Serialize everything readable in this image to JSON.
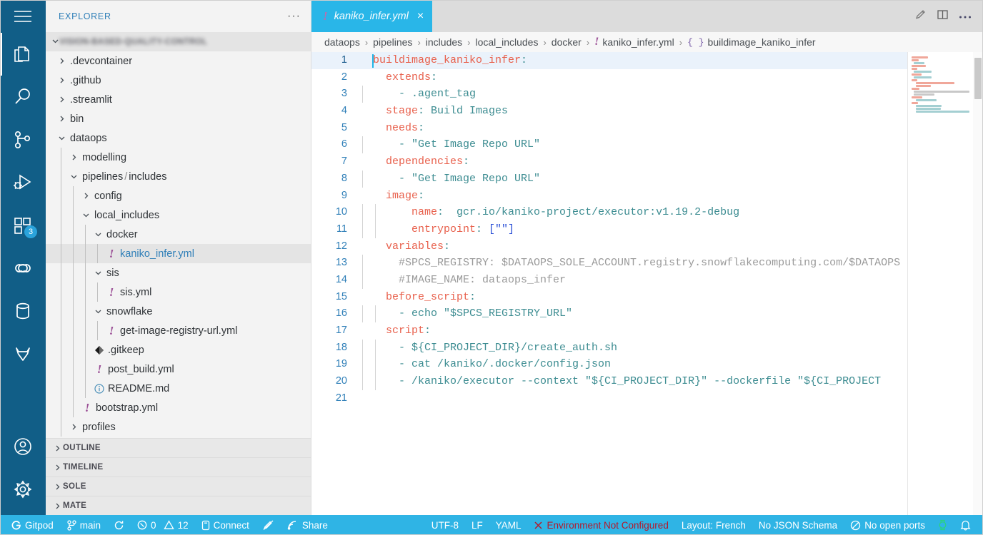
{
  "activitybar": {
    "items": [
      {
        "name": "menu-hamburger",
        "icon": "hamburger-icon",
        "label": "Menu"
      },
      {
        "name": "explorer",
        "icon": "files-icon",
        "label": "Explorer",
        "active": true
      },
      {
        "name": "search",
        "icon": "search-icon",
        "label": "Search"
      },
      {
        "name": "source-control",
        "icon": "source-control-icon",
        "label": "Source Control"
      },
      {
        "name": "run-debug",
        "icon": "run-and-debug-icon",
        "label": "Run and Debug"
      },
      {
        "name": "extensions",
        "icon": "extensions-icon",
        "label": "Extensions",
        "badge": "3"
      },
      {
        "name": "link",
        "icon": "chain-link-icon",
        "label": "Connections"
      },
      {
        "name": "database",
        "icon": "database-icon",
        "label": "Database"
      },
      {
        "name": "gitlab",
        "icon": "gitlab-fox-icon",
        "label": "GitLab"
      }
    ],
    "bottom_items": [
      {
        "name": "accounts",
        "icon": "account-circle-icon",
        "label": "Accounts"
      },
      {
        "name": "manage",
        "icon": "gear-icon",
        "label": "Manage"
      }
    ]
  },
  "sidebar": {
    "title": "EXPLORER",
    "more_actions": "···",
    "workspace": "VISION-BASED-QUALITY-CONTROL",
    "tree": [
      {
        "label": ".devcontainer",
        "type": "folder",
        "expanded": false,
        "depth": 1
      },
      {
        "label": ".github",
        "type": "folder",
        "expanded": false,
        "depth": 1
      },
      {
        "label": ".streamlit",
        "type": "folder",
        "expanded": false,
        "depth": 1
      },
      {
        "label": "bin",
        "type": "folder",
        "expanded": false,
        "depth": 1
      },
      {
        "label": "dataops",
        "type": "folder",
        "expanded": true,
        "depth": 1
      },
      {
        "label": "modelling",
        "type": "folder",
        "expanded": false,
        "depth": 2
      },
      {
        "label": "pipelines",
        "label2": "includes",
        "type": "folder",
        "expanded": true,
        "depth": 2
      },
      {
        "label": "config",
        "type": "folder",
        "expanded": false,
        "depth": 3
      },
      {
        "label": "local_includes",
        "type": "folder",
        "expanded": true,
        "depth": 3
      },
      {
        "label": "docker",
        "type": "folder",
        "expanded": true,
        "depth": 4
      },
      {
        "label": "kaniko_infer.yml",
        "type": "file",
        "icon": "yaml-icon",
        "depth": 5,
        "selected": true
      },
      {
        "label": "sis",
        "type": "folder",
        "expanded": true,
        "depth": 4
      },
      {
        "label": "sis.yml",
        "type": "file",
        "icon": "yaml-icon",
        "depth": 5
      },
      {
        "label": "snowflake",
        "type": "folder",
        "expanded": true,
        "depth": 4
      },
      {
        "label": "get-image-registry-url.yml",
        "type": "file",
        "icon": "yaml-icon",
        "depth": 5
      },
      {
        "label": ".gitkeep",
        "type": "file",
        "icon": "git-icon",
        "depth": 4
      },
      {
        "label": "post_build.yml",
        "type": "file",
        "icon": "yaml-icon",
        "depth": 4
      },
      {
        "label": "README.md",
        "type": "file",
        "icon": "info-icon",
        "depth": 4
      },
      {
        "label": "bootstrap.yml",
        "type": "file",
        "icon": "yaml-icon",
        "depth": 3
      },
      {
        "label": "profiles",
        "type": "folder",
        "expanded": false,
        "depth": 2
      }
    ],
    "sections": [
      "OUTLINE",
      "TIMELINE",
      "SOLE",
      "MATE"
    ]
  },
  "editor": {
    "tab": {
      "filename": "kaniko_infer.yml",
      "icon": "yaml-icon",
      "close": "×",
      "active": true
    },
    "actions": [
      {
        "name": "edit-pencil-icon",
        "label": "Edit"
      },
      {
        "name": "split-editor-icon",
        "label": "Split Editor"
      },
      {
        "name": "more-actions-icon",
        "label": "More Actions"
      }
    ],
    "breadcrumbs": [
      "dataops",
      "pipelines",
      "includes",
      "local_includes",
      "docker",
      "kaniko_infer.yml",
      "buildimage_kaniko_infer"
    ],
    "breadcrumb_file_index": 5,
    "breadcrumb_symbol": "{ }",
    "language": "YAML",
    "cursor_line": 1,
    "lines": [
      {
        "n": 1,
        "indent": 0,
        "highlight": true,
        "tokens": [
          {
            "t": "buildimage_kaniko_infer",
            "c": "key"
          },
          {
            "t": ":",
            "c": "punct"
          }
        ]
      },
      {
        "n": 2,
        "indent": 0,
        "tokens": [
          {
            "t": "  ",
            "c": "plain"
          },
          {
            "t": "extends",
            "c": "key"
          },
          {
            "t": ":",
            "c": "punct"
          }
        ]
      },
      {
        "n": 3,
        "indent": 1,
        "tokens": [
          {
            "t": "    - .agent_tag",
            "c": "val"
          }
        ]
      },
      {
        "n": 4,
        "indent": 0,
        "tokens": [
          {
            "t": "  ",
            "c": "plain"
          },
          {
            "t": "stage",
            "c": "key"
          },
          {
            "t": ": Build Images",
            "c": "val"
          }
        ]
      },
      {
        "n": 5,
        "indent": 0,
        "tokens": [
          {
            "t": "  ",
            "c": "plain"
          },
          {
            "t": "needs",
            "c": "key"
          },
          {
            "t": ":",
            "c": "punct"
          }
        ]
      },
      {
        "n": 6,
        "indent": 1,
        "tokens": [
          {
            "t": "    - \"Get Image Repo URL\"",
            "c": "val"
          }
        ]
      },
      {
        "n": 7,
        "indent": 0,
        "tokens": [
          {
            "t": "  ",
            "c": "plain"
          },
          {
            "t": "dependencies",
            "c": "key"
          },
          {
            "t": ":",
            "c": "punct"
          }
        ]
      },
      {
        "n": 8,
        "indent": 1,
        "tokens": [
          {
            "t": "    - \"Get Image Repo URL\"",
            "c": "val"
          }
        ]
      },
      {
        "n": 9,
        "indent": 0,
        "tokens": [
          {
            "t": "  ",
            "c": "plain"
          },
          {
            "t": "image",
            "c": "key"
          },
          {
            "t": ":",
            "c": "punct"
          }
        ]
      },
      {
        "n": 10,
        "indent": 2,
        "tokens": [
          {
            "t": "      ",
            "c": "plain"
          },
          {
            "t": "name",
            "c": "key"
          },
          {
            "t": ":  gcr.io/kaniko-project/executor:v1.19.2-debug",
            "c": "val"
          }
        ]
      },
      {
        "n": 11,
        "indent": 2,
        "tokens": [
          {
            "t": "      ",
            "c": "plain"
          },
          {
            "t": "entrypoint",
            "c": "key"
          },
          {
            "t": ": ",
            "c": "punct"
          },
          {
            "t": "[\"\"]",
            "c": "bracket"
          }
        ]
      },
      {
        "n": 12,
        "indent": 0,
        "tokens": [
          {
            "t": "  ",
            "c": "plain"
          },
          {
            "t": "variables",
            "c": "key"
          },
          {
            "t": ":",
            "c": "punct"
          }
        ]
      },
      {
        "n": 13,
        "indent": 1,
        "tokens": [
          {
            "t": "    #SPCS_REGISTRY: $DATAOPS_SOLE_ACCOUNT.registry.snowflakecomputing.com/$DATAOPS",
            "c": "comment"
          }
        ]
      },
      {
        "n": 14,
        "indent": 1,
        "tokens": [
          {
            "t": "    #IMAGE_NAME: dataops_infer",
            "c": "comment"
          }
        ]
      },
      {
        "n": 15,
        "indent": 0,
        "tokens": [
          {
            "t": "  ",
            "c": "plain"
          },
          {
            "t": "before_script",
            "c": "key"
          },
          {
            "t": ":",
            "c": "punct"
          }
        ]
      },
      {
        "n": 16,
        "indent": 2,
        "tokens": [
          {
            "t": "    - echo \"$SPCS_REGISTRY_URL\"",
            "c": "val"
          }
        ]
      },
      {
        "n": 17,
        "indent": 0,
        "tokens": [
          {
            "t": "  ",
            "c": "plain"
          },
          {
            "t": "script",
            "c": "key"
          },
          {
            "t": ":",
            "c": "punct"
          }
        ]
      },
      {
        "n": 18,
        "indent": 2,
        "tokens": [
          {
            "t": "    - ${CI_PROJECT_DIR}/create_auth.sh",
            "c": "val"
          }
        ]
      },
      {
        "n": 19,
        "indent": 2,
        "tokens": [
          {
            "t": "    - cat /kaniko/.docker/config.json",
            "c": "val"
          }
        ]
      },
      {
        "n": 20,
        "indent": 2,
        "tokens": [
          {
            "t": "    - /kaniko/executor --context \"${CI_PROJECT_DIR}\" --dockerfile \"${CI_PROJECT",
            "c": "val"
          }
        ]
      },
      {
        "n": 21,
        "indent": 0,
        "tokens": []
      }
    ]
  },
  "statusbar": {
    "left": [
      {
        "name": "gitpod",
        "icon": "gitpod-icon",
        "label": "Gitpod"
      },
      {
        "name": "branch",
        "icon": "branch-icon",
        "label": "main"
      },
      {
        "name": "sync",
        "icon": "sync-icon",
        "label": ""
      },
      {
        "name": "problems",
        "icon": "error-warning-icon",
        "label": "0",
        "label2": "12"
      },
      {
        "name": "connect",
        "icon": "remote-icon",
        "label": "Connect"
      },
      {
        "name": "ports-toggle",
        "icon": "pencil-slash-icon",
        "label": ""
      },
      {
        "name": "share",
        "icon": "share-icon",
        "label": "Share"
      }
    ],
    "right": [
      {
        "name": "encoding",
        "label": "UTF-8"
      },
      {
        "name": "eol",
        "label": "LF"
      },
      {
        "name": "language-mode",
        "label": "YAML"
      },
      {
        "name": "environment",
        "icon": "x-icon",
        "label": "Environment Not Configured",
        "error": true
      },
      {
        "name": "layout",
        "label": "Layout: French"
      },
      {
        "name": "json-schema",
        "label": "No JSON Schema"
      },
      {
        "name": "open-ports",
        "icon": "no-ports-icon",
        "label": "No open ports"
      },
      {
        "name": "watch",
        "icon": "watch-icon",
        "label": ""
      },
      {
        "name": "notifications",
        "icon": "bell-icon",
        "label": ""
      }
    ]
  },
  "colors": {
    "activitybar_bg": "#115E87",
    "statusbar_bg": "#2FB4E5",
    "tab_active_bg": "#29B6E8",
    "sidebar_bg": "#F3F3F3",
    "accent": "#2f7fb8",
    "key_token": "#E8604C",
    "value_token": "#3C8C91",
    "comment_token": "#9a9a9a",
    "error": "#B5192B"
  }
}
